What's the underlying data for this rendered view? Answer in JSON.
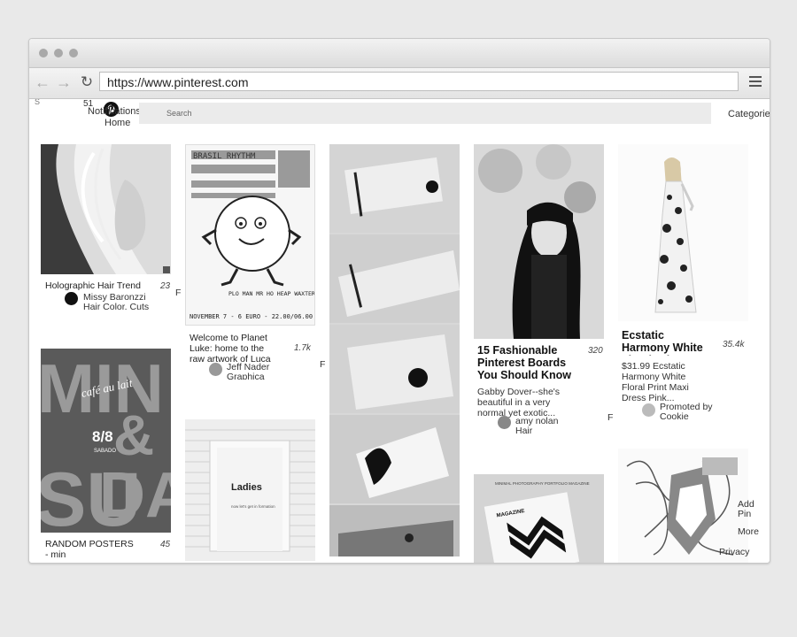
{
  "browser": {
    "url": "https://www.pinterest.com"
  },
  "header": {
    "left_stub": "S",
    "notif_count": "51",
    "notifications": "Notifications",
    "home": "Home",
    "search_placeholder": "Search",
    "categories": "Categories"
  },
  "pins": [
    {
      "title": "Holographic Hair Trend",
      "count": "23",
      "source": "Missy Baronzzi",
      "board": "Hair Color. Cuts",
      "side": "F"
    },
    {
      "title": "Welcome to Planet Luke: home to the raw artwork of Luca",
      "count": "1.7k",
      "source": "Jeff Nader",
      "board": "Graphica",
      "side": "F"
    },
    {
      "title": "15 Fashionable Pinterest Boards You Should Know",
      "count": "320",
      "desc": "Gabby Dover--she's beautiful in a very normal yet exotic...",
      "source": "amy nolan",
      "board": "Hair",
      "side": "F"
    },
    {
      "title": "Ecstatic Harmony White Floral Print",
      "count": "35.4k",
      "desc": "$31.99 Ecstatic Harmony White Floral Print Maxi Dress Pink...",
      "source": "Promoted by",
      "board": "Cookie"
    },
    {
      "title": "RANDOM POSTERS - min",
      "count": "45"
    }
  ],
  "poster": {
    "min": "MIN",
    "su": "SU",
    "amp": "&",
    "da": "DA",
    "cafe": "café au lait",
    "date": "8/8",
    "day": "SABADO"
  },
  "planet_poster": {
    "top": "BRASIL RHYTHM",
    "names": "PLO MAN MR HO HEAP WAXTER DANCEL",
    "footer": "NOVEMBER 7 - 6 EURO - 22.00/06.00"
  },
  "ladies": {
    "label": "Ladies",
    "lines": "now let's get in formation"
  },
  "magazine": {
    "header": "MINIMAL PHOTOGRAPHY PORTFOLIO MAGAZINE",
    "label": "MAGAZINE"
  },
  "side_actions": {
    "add": "Add",
    "pin": "Pin",
    "more": "More",
    "privacy": "Privacy"
  },
  "colors": {
    "bg": "#e9e9e9",
    "accent": "#111111"
  }
}
